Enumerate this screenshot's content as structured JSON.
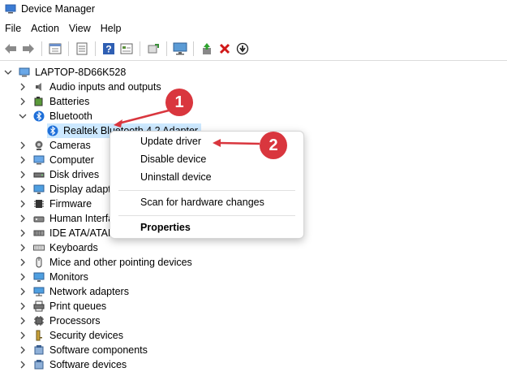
{
  "window": {
    "title": "Device Manager"
  },
  "menu": [
    "File",
    "Action",
    "View",
    "Help"
  ],
  "toolbar": [
    "back-icon",
    "forward-icon",
    "properties-icon",
    "list-icon",
    "help-icon",
    "view-icon",
    "scan-icon",
    "monitor-icon",
    "update-driver-icon",
    "uninstall-icon",
    "download-icon"
  ],
  "tree": {
    "root": "LAPTOP-8D66K528",
    "items": [
      {
        "label": "Audio inputs and outputs",
        "icon": "speaker-icon"
      },
      {
        "label": "Batteries",
        "icon": "battery-icon"
      },
      {
        "label": "Bluetooth",
        "icon": "bluetooth-icon",
        "expanded": true
      },
      {
        "label": "Realtek Bluetooth 4.2 Adapter",
        "icon": "bluetooth-icon",
        "child": true,
        "selected": true
      },
      {
        "label": "Cameras",
        "icon": "camera-icon"
      },
      {
        "label": "Computer",
        "icon": "computer-icon"
      },
      {
        "label": "Disk drives",
        "icon": "disk-icon"
      },
      {
        "label": "Display adapte",
        "icon": "display-icon"
      },
      {
        "label": "Firmware",
        "icon": "firmware-icon"
      },
      {
        "label": "Human Interfa",
        "icon": "hid-icon"
      },
      {
        "label": "IDE ATA/ATAPI",
        "icon": "ide-icon"
      },
      {
        "label": "Keyboards",
        "icon": "keyboard-icon"
      },
      {
        "label": "Mice and other pointing devices",
        "icon": "mouse-icon"
      },
      {
        "label": "Monitors",
        "icon": "monitor-icon"
      },
      {
        "label": "Network adapters",
        "icon": "network-icon"
      },
      {
        "label": "Print queues",
        "icon": "printer-icon"
      },
      {
        "label": "Processors",
        "icon": "processor-icon"
      },
      {
        "label": "Security devices",
        "icon": "security-icon"
      },
      {
        "label": "Software components",
        "icon": "software-icon"
      },
      {
        "label": "Software devices",
        "icon": "software-icon"
      }
    ]
  },
  "context_menu": {
    "update": "Update driver",
    "disable": "Disable device",
    "uninstall": "Uninstall device",
    "scan": "Scan for hardware changes",
    "properties": "Properties"
  },
  "callouts": {
    "one": "1",
    "two": "2"
  },
  "colors": {
    "accent": "#d9363e",
    "selection": "#cce8ff",
    "bluetooth": "#1e6fd9"
  }
}
